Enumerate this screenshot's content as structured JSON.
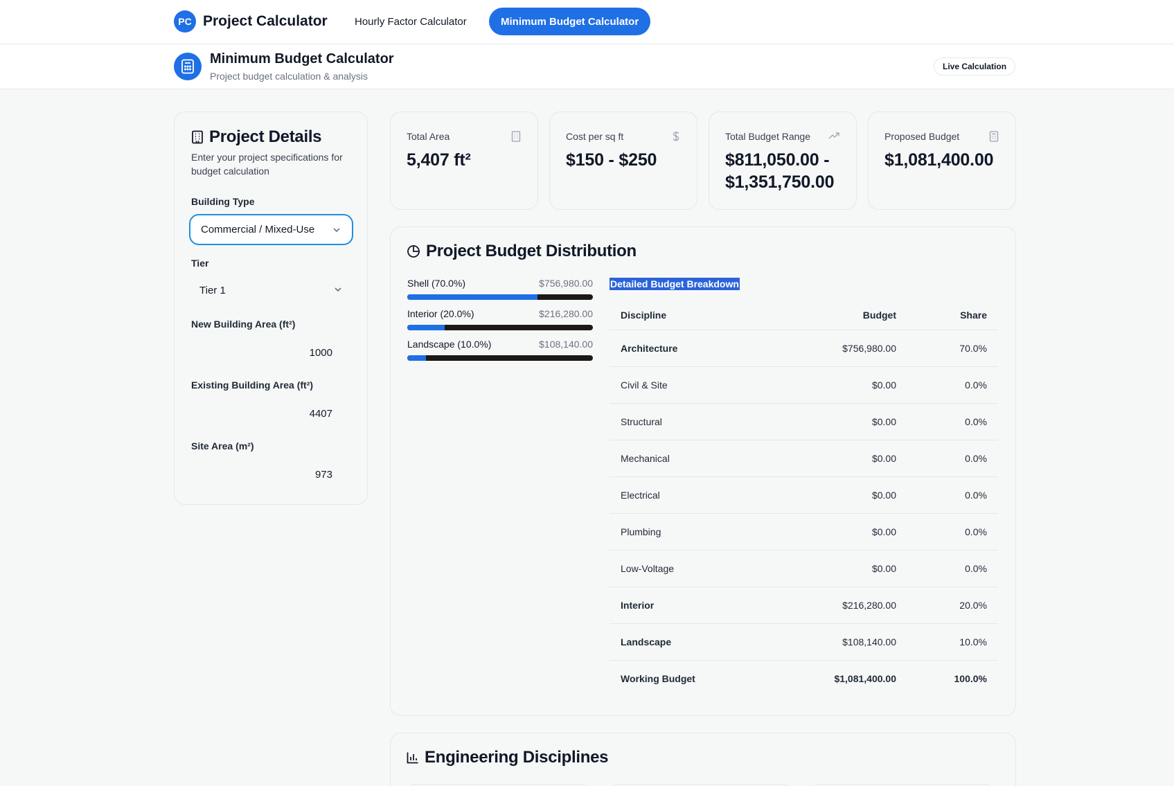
{
  "nav": {
    "logo_initials": "PC",
    "brand_title": "Project Calculator",
    "tabs": [
      {
        "label": "Hourly Factor Calculator",
        "active": false
      },
      {
        "label": "Minimum Budget Calculator",
        "active": true
      }
    ]
  },
  "header": {
    "title": "Minimum Budget Calculator",
    "subtitle": "Project budget calculation & analysis",
    "badge": "Live Calculation"
  },
  "details": {
    "title": "Project Details",
    "description": "Enter your project specifications for budget calculation",
    "building_type_label": "Building Type",
    "building_type_value": "Commercial / Mixed-Use",
    "tier_label": "Tier",
    "tier_value": "Tier 1",
    "new_area_label": "New Building Area (ft²)",
    "new_area_value": "1000",
    "existing_area_label": "Existing Building Area (ft²)",
    "existing_area_value": "4407",
    "site_area_label": "Site Area (m²)",
    "site_area_value": "973"
  },
  "stats": [
    {
      "label": "Total Area",
      "value": "5,407 ft²",
      "icon": "building-icon"
    },
    {
      "label": "Cost per sq ft",
      "value": "$150 - $250",
      "icon": "dollar-icon"
    },
    {
      "label": "Total Budget Range",
      "value": "$811,050.00 - $1,351,750.00",
      "icon": "trending-up-icon"
    },
    {
      "label": "Proposed Budget",
      "value": "$1,081,400.00",
      "icon": "calculator-icon"
    }
  ],
  "distribution": {
    "title": "Project Budget Distribution",
    "bars": [
      {
        "label": "Shell (70.0%)",
        "value": "$756,980.00",
        "percent": 70.0
      },
      {
        "label": "Interior (20.0%)",
        "value": "$216,280.00",
        "percent": 20.0
      },
      {
        "label": "Landscape (10.0%)",
        "value": "$108,140.00",
        "percent": 10.0
      }
    ],
    "breakdown_title": "Detailed Budget Breakdown",
    "columns": [
      "Discipline",
      "Budget",
      "Share"
    ],
    "rows": [
      {
        "discipline": "Architecture",
        "budget": "$756,980.00",
        "share": "70.0%"
      },
      {
        "discipline": "Civil & Site",
        "budget": "$0.00",
        "share": "0.0%"
      },
      {
        "discipline": "Structural",
        "budget": "$0.00",
        "share": "0.0%"
      },
      {
        "discipline": "Mechanical",
        "budget": "$0.00",
        "share": "0.0%"
      },
      {
        "discipline": "Electrical",
        "budget": "$0.00",
        "share": "0.0%"
      },
      {
        "discipline": "Plumbing",
        "budget": "$0.00",
        "share": "0.0%"
      },
      {
        "discipline": "Low-Voltage",
        "budget": "$0.00",
        "share": "0.0%"
      },
      {
        "discipline": "Interior",
        "budget": "$216,280.00",
        "share": "20.0%"
      },
      {
        "discipline": "Landscape",
        "budget": "$108,140.00",
        "share": "10.0%"
      },
      {
        "discipline": "Working Budget",
        "budget": "$1,081,400.00",
        "share": "100.0%"
      }
    ]
  },
  "engineering": {
    "title": "Engineering Disciplines"
  },
  "colors": {
    "accent": "#1f6fe5",
    "focus_ring": "#1f8fe0",
    "bar_track": "#1c1917",
    "selection": "#2b63d9"
  }
}
